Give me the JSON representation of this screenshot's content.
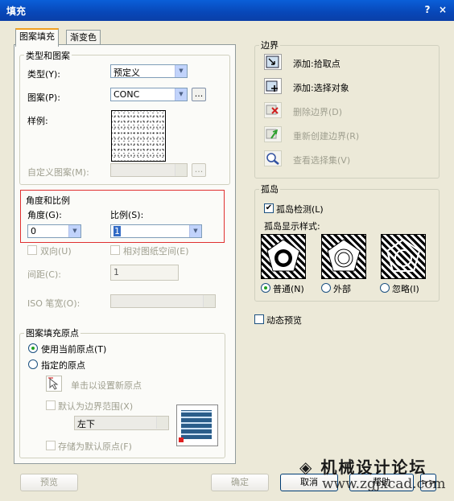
{
  "window": {
    "title": "填充",
    "help_btn": "?",
    "close_btn": "×"
  },
  "tabs": [
    {
      "label": "图案填充"
    },
    {
      "label": "渐变色"
    }
  ],
  "type_pattern": {
    "group_label": "类型和图案",
    "type_label": "类型(Y):",
    "type_value": "预定义",
    "pattern_label": "图案(P):",
    "pattern_value": "CONC",
    "browse": "...",
    "sample_label": "样例:",
    "custom_label": "自定义图案(M):",
    "custom_browse": "..."
  },
  "angle_scale": {
    "group_label": "角度和比例",
    "angle_label": "角度(G):",
    "angle_value": "0",
    "scale_label": "比例(S):",
    "scale_value": "1",
    "double_label": "双向(U)",
    "relative_label": "相对图纸空间(E)",
    "spacing_label": "间距(C):",
    "spacing_value": "1",
    "iso_label": "ISO 笔宽(O):"
  },
  "origin": {
    "group_label": "图案填充原点",
    "use_current": "使用当前原点(T)",
    "specified": "指定的原点",
    "click_set": "单击以设置新原点",
    "default_extent": "默认为边界范围(X)",
    "extent_value": "左下",
    "store_default": "存储为默认原点(F)"
  },
  "boundaries": {
    "group_label": "边界",
    "add_pick": "添加:拾取点",
    "add_select": "添加:选择对象",
    "remove": "删除边界(D)",
    "recreate": "重新创建边界(R)",
    "view": "查看选择集(V)"
  },
  "islands": {
    "group_label": "孤岛",
    "detect": "孤岛检测(L)",
    "style_label": "孤岛显示样式:",
    "normal": "普通(N)",
    "outer": "外部",
    "ignore": "忽略(I)"
  },
  "preview_label": "动态预览",
  "buttons": {
    "preview": "预览",
    "ok": "确定",
    "cancel": "取消",
    "help": "帮助",
    "more": ">>"
  },
  "watermark": {
    "text": "机械设计论坛",
    "url": "www.zgjxcad.com"
  },
  "colors": {
    "title_bar": "#0a5fd8",
    "dialog_bg": "#ece9d8",
    "highlight_border": "#e03030"
  }
}
